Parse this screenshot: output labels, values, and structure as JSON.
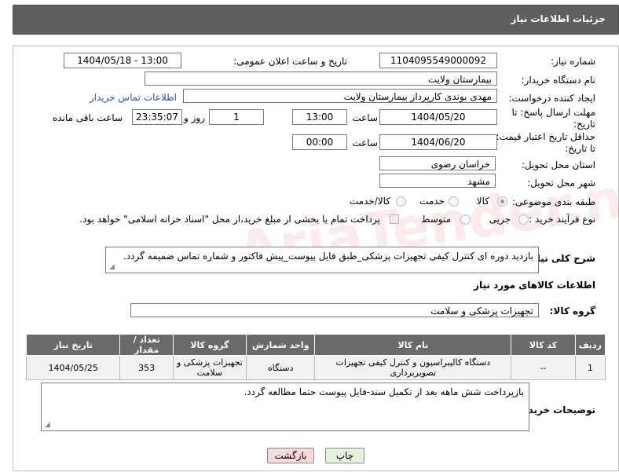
{
  "header": {
    "title": "جزئیات اطلاعات نیاز"
  },
  "fields": {
    "need_number_label": "شماره نیاز:",
    "need_number": "1104095549000092",
    "announce_label": "تاریخ و ساعت اعلان عمومی:",
    "announce_value": "1404/05/18 - 13:00",
    "buyer_org_label": "نام دستگاه خریدار:",
    "buyer_org": "بیمارستان ولایت",
    "creator_label": "ایجاد کننده درخواست:",
    "creator": "مهدی بوندی کارپرداز بیمارستان ولایت",
    "buyer_contact_link": "اطلاعات تماس خریدار",
    "deadline_label": "مهلت ارسال پاسخ: تا تاریخ:",
    "deadline_date": "1404/05/20",
    "hour_label": "ساعت",
    "deadline_time": "13:00",
    "days_value": "1",
    "days_label": "روز و",
    "remaining_time": "23:35:07",
    "remaining_label": "ساعت باقی مانده",
    "validity_label": "حداقل تاریخ اعتبار قیمت: تا تاریخ:",
    "validity_date": "1404/06/20",
    "validity_time": "00:00",
    "province_label": "استان محل تحویل:",
    "province": "خراسان رضوی",
    "city_label": "شهر محل تحویل:",
    "city": "مشهد",
    "category_label": "طبقه بندی موضوعی:",
    "category_options": [
      "کالا",
      "خدمت",
      "کالا/خدمت"
    ],
    "process_label": "نوع فرآیند خرید :",
    "process_options": [
      "جزیی",
      "متوسط"
    ],
    "payment_note": "پرداخت تمام یا بخشی از مبلغ خرید،از محل \"اسناد خزانه اسلامی\" خواهد بود.",
    "summary_label": "شرح کلی نیاز:",
    "summary": "بازدید دوره ای کنترل کیفی تجهیزات پزشکی_طبق فایل پیوست_پیش فاکتور و شماره تماس ضمیمه گردد.",
    "goods_info_title": "اطلاعات کالاهای مورد نیاز",
    "goods_group_label": "گروه کالا:",
    "goods_group": "تجهیزات پزشکی و سلامت",
    "buyer_notes_label": "توضیحات خریدار:",
    "buyer_notes": "بازپرداخت شش ماهه بعد از تکمیل سند-فایل پیوست حتما مطالعه گردد."
  },
  "table": {
    "columns": [
      "ردیف",
      "کد کالا",
      "نام کالا",
      "واحد شمارش",
      "گروه کالا",
      "تعداد / مقدار",
      "تاریخ نیاز"
    ],
    "rows": [
      [
        "1",
        "--",
        "دستگاه کالیبراسیون و کنترل کیفی تجهیزات تصویربرداری",
        "دستگاه",
        "تجهیزات پزشکی و سلامت",
        "353",
        "1404/05/25"
      ]
    ]
  },
  "buttons": {
    "print": "چاپ",
    "back": "بازگشت"
  },
  "colors": {
    "header_bg": "#5f5f5f",
    "table_header_bg": "#6a6a6a",
    "back_button_bg": "#f8d7d7",
    "print_button_bg": "#e0f0d8"
  }
}
